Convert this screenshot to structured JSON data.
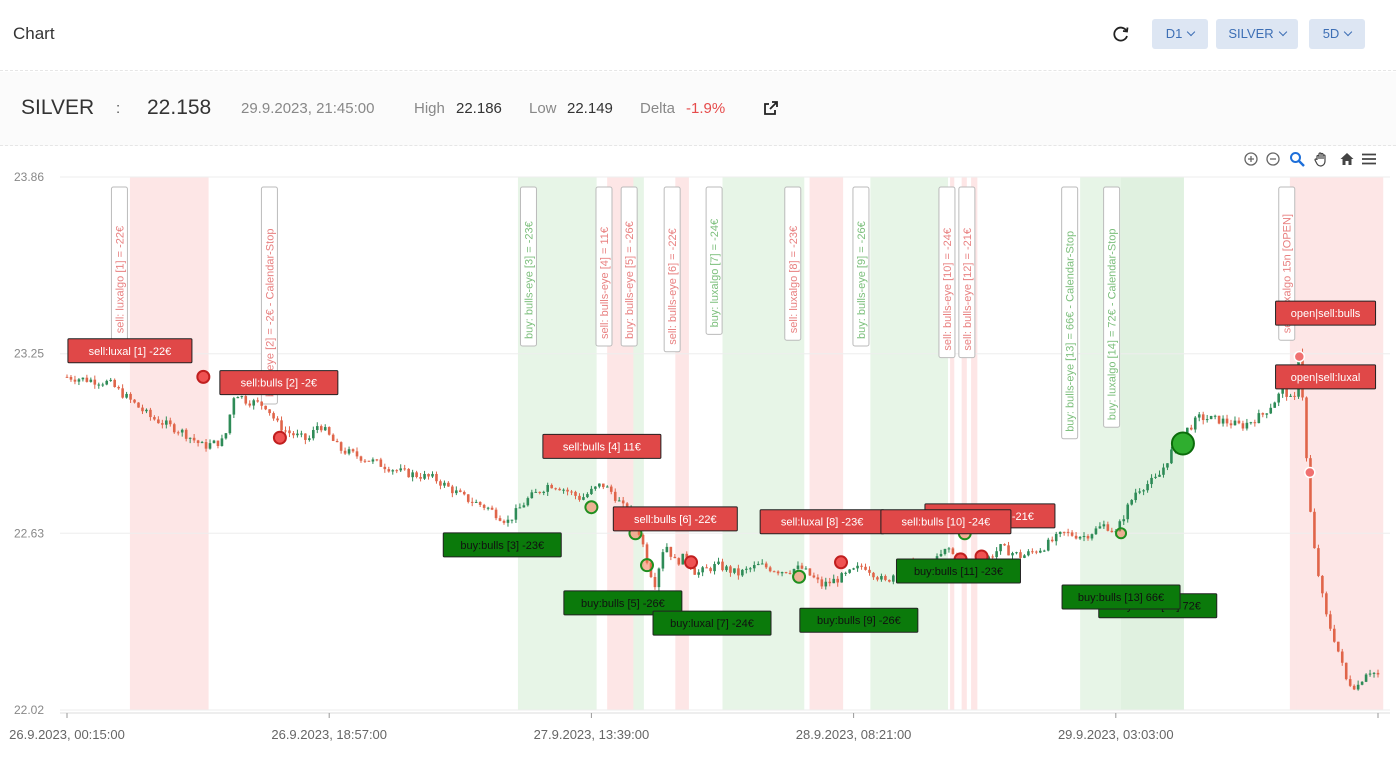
{
  "header": {
    "title": "Chart",
    "timeframe": "D1",
    "symbol": "SILVER",
    "range": "5D"
  },
  "quote": {
    "symbol": "SILVER",
    "separator": ":",
    "price": "22.158",
    "timestamp": "29.9.2023, 21:45:00",
    "high_label": "High",
    "high_value": "22.186",
    "low_label": "Low",
    "low_value": "22.149",
    "delta_label": "Delta",
    "delta_value": "-1.9%"
  },
  "chart_data": {
    "type": "candlestick",
    "ylim": [
      22.02,
      23.86
    ],
    "y_ticks": [
      "23.86",
      "23.25",
      "22.63",
      "22.02"
    ],
    "x_ticks": [
      "26.9.2023, 00:15:00",
      "26.9.2023, 18:57:00",
      "27.9.2023, 13:39:00",
      "28.9.2023, 08:21:00",
      "29.9.2023, 03:03:00"
    ],
    "price_path": [
      [
        0,
        23.17
      ],
      [
        4,
        23.15
      ],
      [
        6,
        23.09
      ],
      [
        8,
        23.03
      ],
      [
        11,
        22.98
      ],
      [
        13,
        22.93
      ],
      [
        15,
        22.95
      ],
      [
        16,
        23.12
      ],
      [
        17,
        23.09
      ],
      [
        19,
        23.07
      ],
      [
        20,
        23.01
      ],
      [
        21,
        22.98
      ],
      [
        23,
        22.95
      ],
      [
        24,
        23.01
      ],
      [
        26,
        22.92
      ],
      [
        29,
        22.88
      ],
      [
        32,
        22.84
      ],
      [
        35,
        22.82
      ],
      [
        38,
        22.75
      ],
      [
        40,
        22.72
      ],
      [
        42,
        22.67
      ],
      [
        44,
        22.75
      ],
      [
        46,
        22.8
      ],
      [
        47,
        22.79
      ],
      [
        49,
        22.75
      ],
      [
        51,
        22.8
      ],
      [
        52,
        22.77
      ],
      [
        53,
        22.72
      ],
      [
        54,
        22.7
      ],
      [
        55,
        22.58
      ],
      [
        56,
        22.45
      ],
      [
        57,
        22.6
      ],
      [
        58,
        22.53
      ],
      [
        59,
        22.55
      ],
      [
        60,
        22.49
      ],
      [
        62,
        22.52
      ],
      [
        64,
        22.49
      ],
      [
        66,
        22.52
      ],
      [
        68,
        22.5
      ],
      [
        70,
        22.51
      ],
      [
        72,
        22.45
      ],
      [
        74,
        22.48
      ],
      [
        76,
        22.52
      ],
      [
        78,
        22.46
      ],
      [
        80,
        22.53
      ],
      [
        82,
        22.5
      ],
      [
        84,
        22.58
      ],
      [
        86,
        22.48
      ],
      [
        87,
        22.52
      ],
      [
        89,
        22.58
      ],
      [
        91,
        22.55
      ],
      [
        93,
        22.58
      ],
      [
        95,
        22.63
      ],
      [
        97,
        22.62
      ],
      [
        99,
        22.66
      ],
      [
        100,
        22.63
      ],
      [
        101,
        22.71
      ],
      [
        102,
        22.78
      ],
      [
        104,
        22.82
      ],
      [
        106,
        22.96
      ],
      [
        108,
        23.03
      ],
      [
        110,
        23.02
      ],
      [
        112,
        23.0
      ],
      [
        114,
        23.04
      ],
      [
        115,
        23.08
      ],
      [
        116,
        23.13
      ],
      [
        117,
        23.07
      ],
      [
        117.5,
        23.3
      ],
      [
        118,
        22.98
      ],
      [
        118.5,
        22.72
      ],
      [
        119,
        22.55
      ],
      [
        120,
        22.35
      ],
      [
        121,
        22.25
      ],
      [
        122,
        22.12
      ],
      [
        123,
        22.1
      ],
      [
        124,
        22.16
      ],
      [
        125,
        22.14
      ]
    ],
    "price_x_max": 125,
    "zones": [
      {
        "from": 6,
        "to": 13.5,
        "side": "sell"
      },
      {
        "from": 43,
        "to": 50.5,
        "side": "buy"
      },
      {
        "from": 51.5,
        "to": 54,
        "side": "sell"
      },
      {
        "from": 54,
        "to": 55,
        "side": "buy"
      },
      {
        "from": 58,
        "to": 59.3,
        "side": "sell"
      },
      {
        "from": 62.5,
        "to": 70.3,
        "side": "buy"
      },
      {
        "from": 70.8,
        "to": 74,
        "side": "sell"
      },
      {
        "from": 76.6,
        "to": 84,
        "side": "buy"
      },
      {
        "from": 84.2,
        "to": 84.6,
        "side": "sell"
      },
      {
        "from": 85.3,
        "to": 85.8,
        "side": "sell"
      },
      {
        "from": 86.2,
        "to": 86.8,
        "side": "sell"
      },
      {
        "from": 96.6,
        "to": 100.5,
        "side": "buy"
      },
      {
        "from": 100.5,
        "to": 106.5,
        "side": "buy-strong"
      },
      {
        "from": 116.6,
        "to": 117.2,
        "side": "sell"
      },
      {
        "from": 117.2,
        "to": 125.5,
        "side": "sell"
      }
    ],
    "vertical_labels": [
      {
        "x": 5,
        "side": "sell",
        "text": "sell: luxalgo [1] = -22€"
      },
      {
        "x": 19.3,
        "side": "sell",
        "text": "bulls-eye [2] = -2€ - Calendar-Stop"
      },
      {
        "x": 44,
        "side": "buy",
        "text": "buy: bulls-eye [3] = -23€"
      },
      {
        "x": 51.2,
        "side": "sell",
        "text": "sell: bulls-eye [4] = 11€"
      },
      {
        "x": 53.6,
        "side": "sell",
        "text": "buy: bulls-eye [5] = -26€"
      },
      {
        "x": 57.7,
        "side": "sell",
        "text": "sell: bulls-eye [6] = -22€"
      },
      {
        "x": 61.7,
        "side": "buy",
        "text": "buy: luxalgo [7] = -24€"
      },
      {
        "x": 69.2,
        "side": "sell",
        "text": "sell: luxalgo [8] = -23€"
      },
      {
        "x": 75.7,
        "side": "buy",
        "text": "buy: bulls-eye [9] = -26€"
      },
      {
        "x": 83.9,
        "side": "sell",
        "text": "sell: bulls-eye [10] = -24€"
      },
      {
        "x": 85.8,
        "side": "sell",
        "text": "sell: bulls-eye [12] = -21€"
      },
      {
        "x": 95.6,
        "side": "buy",
        "text": "buy: bulls-eye [13] = 66€ - Calendar-Stop"
      },
      {
        "x": 99.6,
        "side": "buy",
        "text": "buy: luxalgo [14] = 72€ - Calendar-Stop"
      },
      {
        "x": 116.3,
        "side": "sell",
        "text": "sell: luxalgo 15n [OPEN]"
      }
    ],
    "trade_labels": [
      {
        "x": 6.0,
        "y": 23.26,
        "side": "sell",
        "text": "sell:luxal [1] -22€"
      },
      {
        "x": 20.2,
        "y": 23.15,
        "side": "sell",
        "text": "sell:bulls [2] -2€"
      },
      {
        "x": 51.0,
        "y": 22.93,
        "side": "sell",
        "text": "sell:bulls [4] 11€"
      },
      {
        "x": 58.0,
        "y": 22.68,
        "side": "sell",
        "text": "sell:bulls [6] -22€"
      },
      {
        "x": 88.0,
        "y": 22.69,
        "side": "sell",
        "text": "sell:bulls [11] -21€"
      },
      {
        "x": 72.0,
        "y": 22.67,
        "side": "sell",
        "text": "sell:luxal [8] -23€"
      },
      {
        "x": 83.8,
        "y": 22.67,
        "side": "sell",
        "text": "sell:bulls [10] -24€"
      },
      {
        "x": 120.0,
        "y": 23.39,
        "side": "sell",
        "text": "open|sell:bulls"
      },
      {
        "x": 120.0,
        "y": 23.17,
        "side": "sell",
        "text": "open|sell:luxal"
      },
      {
        "x": 41.5,
        "y": 22.59,
        "side": "buy",
        "text": "buy:bulls [3] -23€"
      },
      {
        "x": 53.0,
        "y": 22.39,
        "side": "buy",
        "text": "buy:bulls [5] -26€"
      },
      {
        "x": 61.5,
        "y": 22.32,
        "side": "buy",
        "text": "buy:luxal [7] -24€"
      },
      {
        "x": 75.5,
        "y": 22.33,
        "side": "buy",
        "text": "buy:bulls [9] -26€"
      },
      {
        "x": 104.0,
        "y": 22.38,
        "side": "buy",
        "text": "buy:bulls [14] 72€"
      },
      {
        "x": 85.0,
        "y": 22.5,
        "side": "buy",
        "text": "buy:bulls [11] -23€"
      },
      {
        "x": 100.5,
        "y": 22.41,
        "side": "buy",
        "text": "buy:bulls [13] 66€"
      }
    ],
    "markers": [
      {
        "x": 13.0,
        "y": 23.17,
        "kind": "sell",
        "r": 6
      },
      {
        "x": 20.3,
        "y": 22.96,
        "kind": "sell",
        "r": 6
      },
      {
        "x": 50.0,
        "y": 22.72,
        "kind": "buy-ring",
        "r": 6
      },
      {
        "x": 54.2,
        "y": 22.63,
        "kind": "buy-ring",
        "r": 6
      },
      {
        "x": 55.3,
        "y": 22.52,
        "kind": "buy-ring",
        "r": 6
      },
      {
        "x": 59.5,
        "y": 22.53,
        "kind": "sell",
        "r": 6
      },
      {
        "x": 69.8,
        "y": 22.48,
        "kind": "buy-ring",
        "r": 6
      },
      {
        "x": 73.8,
        "y": 22.53,
        "kind": "sell",
        "r": 6
      },
      {
        "x": 84.0,
        "y": 22.48,
        "kind": "buy",
        "r": 5
      },
      {
        "x": 85.2,
        "y": 22.54,
        "kind": "sell",
        "r": 6
      },
      {
        "x": 85.6,
        "y": 22.63,
        "kind": "buy-ring",
        "r": 6
      },
      {
        "x": 87.2,
        "y": 22.55,
        "kind": "sell",
        "r": 6
      },
      {
        "x": 100.5,
        "y": 22.63,
        "kind": "buy-ring",
        "r": 5
      },
      {
        "x": 106.4,
        "y": 22.94,
        "kind": "buy-big",
        "r": 11
      },
      {
        "x": 117.5,
        "y": 23.24,
        "kind": "sell-small",
        "r": 5
      },
      {
        "x": 118.5,
        "y": 22.84,
        "kind": "sell-small",
        "r": 5
      }
    ]
  },
  "toolbar": {
    "icons": [
      "zoom-in-icon",
      "zoom-out-icon",
      "zoom-select-icon",
      "pan-hand-icon",
      "home-icon",
      "menu-icon"
    ]
  },
  "colors": {
    "sell": "#e04848",
    "buy": "#0b7a0b",
    "up_candle": "#2e8b57",
    "down_candle": "#e0654a"
  }
}
